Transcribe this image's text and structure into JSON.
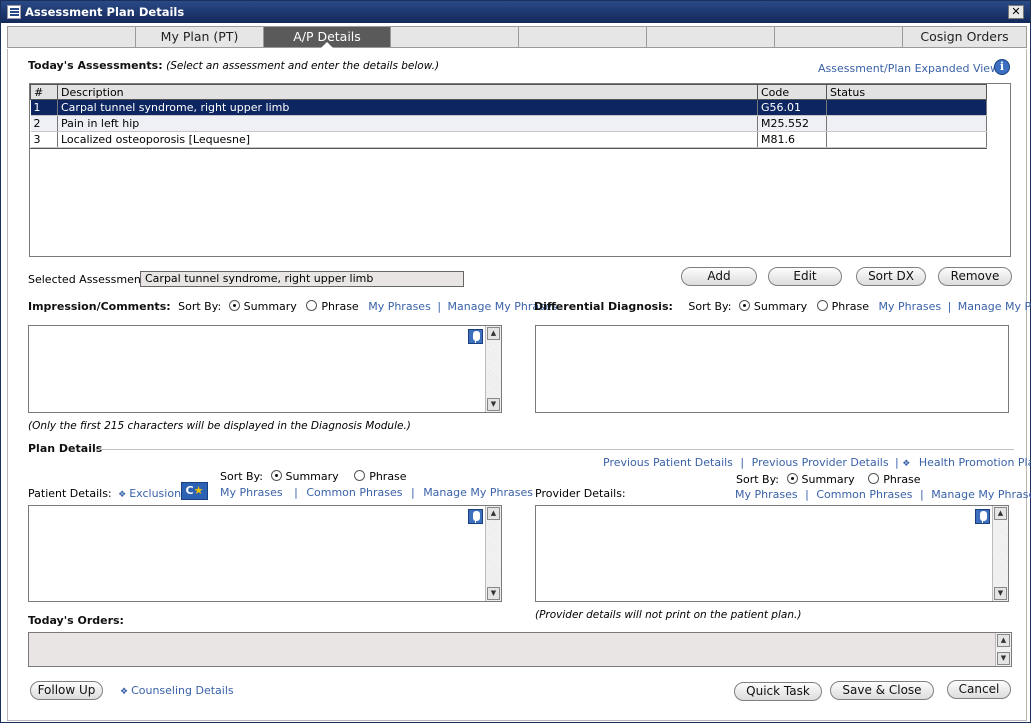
{
  "window": {
    "title": "Assessment Plan Details",
    "close": "✕"
  },
  "tabs": [
    {
      "label": ""
    },
    {
      "label": "My Plan (PT)"
    },
    {
      "label": "A/P Details"
    },
    {
      "label": ""
    },
    {
      "label": ""
    },
    {
      "label": ""
    },
    {
      "label": ""
    },
    {
      "label": "Cosign Orders"
    }
  ],
  "assessments": {
    "title": "Today's Assessments:",
    "hint": "(Select an assessment and enter the details below.)",
    "expanded_view": "Assessment/Plan Expanded View",
    "columns": {
      "num": "#",
      "desc": "Description",
      "code": "Code",
      "status": "Status"
    },
    "rows": [
      {
        "num": "1",
        "desc": "Carpal tunnel syndrome, right upper limb",
        "code": "G56.01",
        "status": ""
      },
      {
        "num": "2",
        "desc": "Pain in left hip",
        "code": "M25.552",
        "status": ""
      },
      {
        "num": "3",
        "desc": "Localized osteoporosis [Lequesne]",
        "code": "M81.6",
        "status": ""
      }
    ],
    "selected_label": "Selected Assessment:",
    "selected_value": "Carpal tunnel syndrome, right upper limb",
    "buttons": {
      "add": "Add",
      "edit": "Edit",
      "sort_dx": "Sort DX",
      "remove": "Remove"
    }
  },
  "impression": {
    "label": "Impression/Comments:",
    "sort_by": "Sort By:",
    "summary": "Summary",
    "phrase": "Phrase",
    "my_phrases": "My Phrases",
    "sep": "|",
    "manage": "Manage My Phrases",
    "note": "(Only the first 215 characters will be displayed in the Diagnosis Module.)"
  },
  "differential": {
    "label": "Differential Diagnosis:",
    "sort_by": "Sort By:",
    "summary": "Summary",
    "phrase": "Phrase",
    "my_phrases": "My Phrases",
    "sep": "|",
    "manage": "Manage My Phrases"
  },
  "plan": {
    "title": "Plan Details",
    "prev_patient": "Previous Patient Details",
    "sep1": "|",
    "prev_provider": "Previous Provider Details",
    "sep2": "|",
    "health_promo": "Health Promotion Plan",
    "patient": {
      "label": "Patient Details:",
      "exclusions": "Exclusions",
      "sort_by": "Sort By:",
      "summary": "Summary",
      "phrase": "Phrase",
      "my_phrases": "My Phrases",
      "sep_a": "|",
      "common": "Common Phrases",
      "sep_b": "|",
      "manage": "Manage My Phrases"
    },
    "provider": {
      "label": "Provider Details:",
      "sort_by": "Sort By:",
      "summary": "Summary",
      "phrase": "Phrase",
      "my_phrases": "My Phrases",
      "sep_a": "|",
      "common": "Common Phrases",
      "sep_b": "|",
      "manage": "Manage My Phrases",
      "note": "(Provider details will not print on the patient plan.)"
    }
  },
  "orders": {
    "label": "Today's Orders:"
  },
  "footer": {
    "follow_up": "Follow Up",
    "counseling": "Counseling Details",
    "quick_task": "Quick Task",
    "save_close": "Save & Close",
    "cancel": "Cancel"
  },
  "icons": {
    "app": "grid-window-icon",
    "info": "i",
    "exclusion_badge_c": "C",
    "exclusion_badge_star": "★",
    "scroll_up": "▲",
    "scroll_down": "▼",
    "diamond": "❖"
  }
}
